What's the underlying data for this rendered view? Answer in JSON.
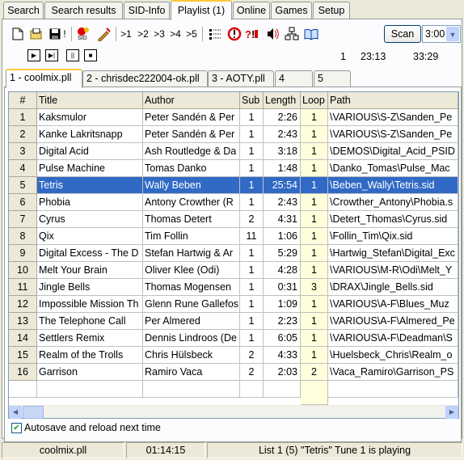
{
  "tabs": [
    {
      "label": "Search"
    },
    {
      "label": "Search results"
    },
    {
      "label": "SID-Info"
    },
    {
      "label": "Playlist (1)"
    },
    {
      "label": "Online"
    },
    {
      "label": "Games"
    },
    {
      "label": "Setup"
    }
  ],
  "toolbar": {
    "track_buttons": [
      ">1",
      ">2",
      ">3",
      ">4",
      ">5"
    ],
    "scan_label": "Scan",
    "time_combo_value": "3:00",
    "info": {
      "current": "1",
      "total_time": "23:13",
      "all_time": "33:29"
    }
  },
  "playlist_tabs": [
    {
      "label": "1 - coolmix.pll"
    },
    {
      "label": "2 - chrisdec222004-ok.pll"
    },
    {
      "label": "3 - AOTY.pll"
    },
    {
      "label": "4"
    },
    {
      "label": "5"
    }
  ],
  "grid": {
    "columns": [
      "#",
      "Title",
      "Author",
      "Sub",
      "Length",
      "Loop",
      "Path"
    ],
    "selected_index": 4,
    "rows": [
      {
        "n": "1",
        "title": "Kaksmulor",
        "author": "Peter Sandén & Per",
        "sub": "1",
        "length": "2:26",
        "loop": "1",
        "path": "\\VARIOUS\\S-Z\\Sanden_Pe"
      },
      {
        "n": "2",
        "title": "Kanke Lakritsnapp",
        "author": "Peter Sandén & Per",
        "sub": "1",
        "length": "2:43",
        "loop": "1",
        "path": "\\VARIOUS\\S-Z\\Sanden_Pe"
      },
      {
        "n": "3",
        "title": "Digital Acid",
        "author": "Ash Routledge & Da",
        "sub": "1",
        "length": "3:18",
        "loop": "1",
        "path": "\\DEMOS\\Digital_Acid_PSID"
      },
      {
        "n": "4",
        "title": "Pulse Machine",
        "author": "Tomas Danko",
        "sub": "1",
        "length": "1:48",
        "loop": "1",
        "path": "\\Danko_Tomas\\Pulse_Mac"
      },
      {
        "n": "5",
        "title": "Tetris",
        "author": "Wally Beben",
        "sub": "1",
        "length": "25:54",
        "loop": "1",
        "path": "\\Beben_Wally\\Tetris.sid"
      },
      {
        "n": "6",
        "title": "Phobia",
        "author": "Antony Crowther (R",
        "sub": "1",
        "length": "2:43",
        "loop": "1",
        "path": "\\Crowther_Antony\\Phobia.s"
      },
      {
        "n": "7",
        "title": "Cyrus",
        "author": "Thomas Detert",
        "sub": "2",
        "length": "4:31",
        "loop": "1",
        "path": "\\Detert_Thomas\\Cyrus.sid"
      },
      {
        "n": "8",
        "title": "Qix",
        "author": "Tim Follin",
        "sub": "11",
        "length": "1:06",
        "loop": "1",
        "path": "\\Follin_Tim\\Qix.sid"
      },
      {
        "n": "9",
        "title": "Digital Excess - The D",
        "author": "Stefan Hartwig & Ar",
        "sub": "1",
        "length": "5:29",
        "loop": "1",
        "path": "\\Hartwig_Stefan\\Digital_Exc"
      },
      {
        "n": "10",
        "title": "Melt Your Brain",
        "author": "Oliver Klee (Odi)",
        "sub": "1",
        "length": "4:28",
        "loop": "1",
        "path": "\\VARIOUS\\M-R\\Odi\\Melt_Y"
      },
      {
        "n": "11",
        "title": "Jingle Bells",
        "author": "Thomas Mogensen",
        "sub": "1",
        "length": "0:31",
        "loop": "3",
        "path": "\\DRAX\\Jingle_Bells.sid"
      },
      {
        "n": "12",
        "title": "Impossible Mission Th",
        "author": "Glenn Rune Gallefos",
        "sub": "1",
        "length": "1:09",
        "loop": "1",
        "path": "\\VARIOUS\\A-F\\Blues_Muz"
      },
      {
        "n": "13",
        "title": "The Telephone Call",
        "author": "Per Almered",
        "sub": "1",
        "length": "2:23",
        "loop": "1",
        "path": "\\VARIOUS\\A-F\\Almered_Pe"
      },
      {
        "n": "14",
        "title": "Settlers Remix",
        "author": "Dennis Lindroos (De",
        "sub": "1",
        "length": "6:05",
        "loop": "1",
        "path": "\\VARIOUS\\A-F\\Deadman\\S"
      },
      {
        "n": "15",
        "title": "Realm of the Trolls",
        "author": "Chris Hülsbeck",
        "sub": "2",
        "length": "4:33",
        "loop": "1",
        "path": "\\Huelsbeck_Chris\\Realm_o"
      },
      {
        "n": "16",
        "title": "Garrison",
        "author": "Ramiro Vaca",
        "sub": "2",
        "length": "2:03",
        "loop": "2",
        "path": "\\Vaca_Ramiro\\Garrison_PS"
      }
    ]
  },
  "autosave": {
    "label": "Autosave and reload next time",
    "checked": true
  },
  "status": {
    "file": "coolmix.pll",
    "time": "01:14:15",
    "message": "List 1 (5) \"Tetris\" Tune 1 is playing"
  }
}
